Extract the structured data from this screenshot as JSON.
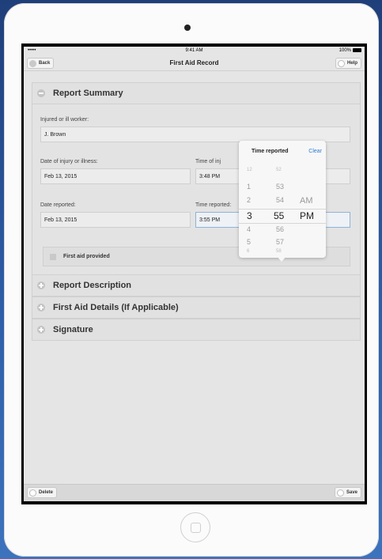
{
  "status": {
    "signal": "•••••",
    "wifi": "wifi-icon",
    "time": "9:41 AM",
    "battery_pct": "100%"
  },
  "nav": {
    "back": "Back",
    "title": "First Aid Record",
    "help": "Help"
  },
  "sections": {
    "report_summary": "Report Summary",
    "report_description": "Report Description",
    "first_aid_details": "First Aid Details (If Applicable)",
    "signature": "Signature"
  },
  "form": {
    "injured_label": "Injured or ill worker:",
    "injured_value": "J. Brown",
    "date_injury_label": "Date of injury or illness:",
    "date_injury_value": "Feb 13, 2015",
    "time_injury_label": "Time of inj",
    "time_injury_value": "3:48 PM",
    "date_reported_label": "Date reported:",
    "date_reported_value": "Feb 13, 2015",
    "time_reported_label": "Time reported:",
    "time_reported_value": "3:55 PM",
    "first_aid_label": "First aid provided"
  },
  "picker": {
    "title": "Time reported",
    "clear": "Clear",
    "hours": [
      "12",
      "1",
      "2",
      "3",
      "4",
      "5",
      "6"
    ],
    "minutes": [
      "52",
      "53",
      "54",
      "55",
      "56",
      "57",
      "58"
    ],
    "ampm": [
      "AM",
      "PM"
    ],
    "selected": {
      "hour": "3",
      "minute": "55",
      "ampm": "PM"
    }
  },
  "toolbar": {
    "delete": "Delete",
    "save": "Save"
  },
  "colors": {
    "accent": "#2e7cd6",
    "background": "#e5e5e5"
  }
}
